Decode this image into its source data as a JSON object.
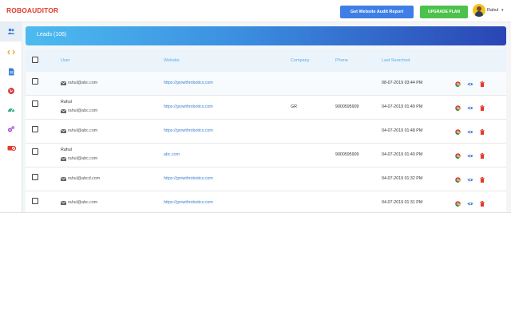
{
  "app": {
    "logo": "ROBOAUDITOR"
  },
  "header": {
    "audit_button": "Get Website Audit Report",
    "upgrade_button": "UPGRADE PLAN",
    "user_name": "Rahul",
    "caret": "▾"
  },
  "sidebar": {
    "items": [
      {
        "icon": "users-icon",
        "active": true
      },
      {
        "icon": "code-icon",
        "active": false
      },
      {
        "icon": "document-icon",
        "active": false
      },
      {
        "icon": "globe-icon",
        "active": false
      },
      {
        "icon": "speedometer-icon",
        "active": false
      },
      {
        "icon": "settings-icon",
        "active": false
      },
      {
        "icon": "ban-icon",
        "active": false
      }
    ]
  },
  "leads": {
    "title": "Leads (106)",
    "columns": {
      "user": "User",
      "website": "Website",
      "company": "Company",
      "phone": "Phone",
      "last_searched": "Last Searched"
    },
    "rows": [
      {
        "name": "",
        "email": "rahul@abc.com",
        "website": "https://growthrobotics.com",
        "company": "",
        "phone": "",
        "last_searched": "08-07-2019 03:44 PM"
      },
      {
        "name": "Rahul",
        "email": "rahul@abc.com",
        "website": "https://growthrobotics.com",
        "company": "GR",
        "phone": "9000595909",
        "last_searched": "04-07-2019 01:49 PM"
      },
      {
        "name": "",
        "email": "rahul@abc.com",
        "website": "https://growthrobotics.com",
        "company": "",
        "phone": "",
        "last_searched": "04-07-2019 01:48 PM"
      },
      {
        "name": "Rahul",
        "email": "rahul@abc.com",
        "website": "abc.com",
        "company": "",
        "phone": "9000595909",
        "last_searched": "04-07-2019 01:40 PM"
      },
      {
        "name": "",
        "email": "rahul@abcd.com",
        "website": "https://growthrobotics.com",
        "company": "",
        "phone": "",
        "last_searched": "04-07-2019 01:32 PM"
      },
      {
        "name": "",
        "email": "rahul@abc.com",
        "website": "https://growthrobotics.com",
        "company": "",
        "phone": "",
        "last_searched": "04-07-2019 01:31 PM"
      }
    ]
  },
  "colors": {
    "brand": "#e23b2e",
    "audit_button": "#3d7fe6",
    "upgrade_button": "#4cc24c",
    "link": "#3a7fd4",
    "header_gradient_start": "#4dbbf0",
    "header_gradient_end": "#2a45b5"
  }
}
